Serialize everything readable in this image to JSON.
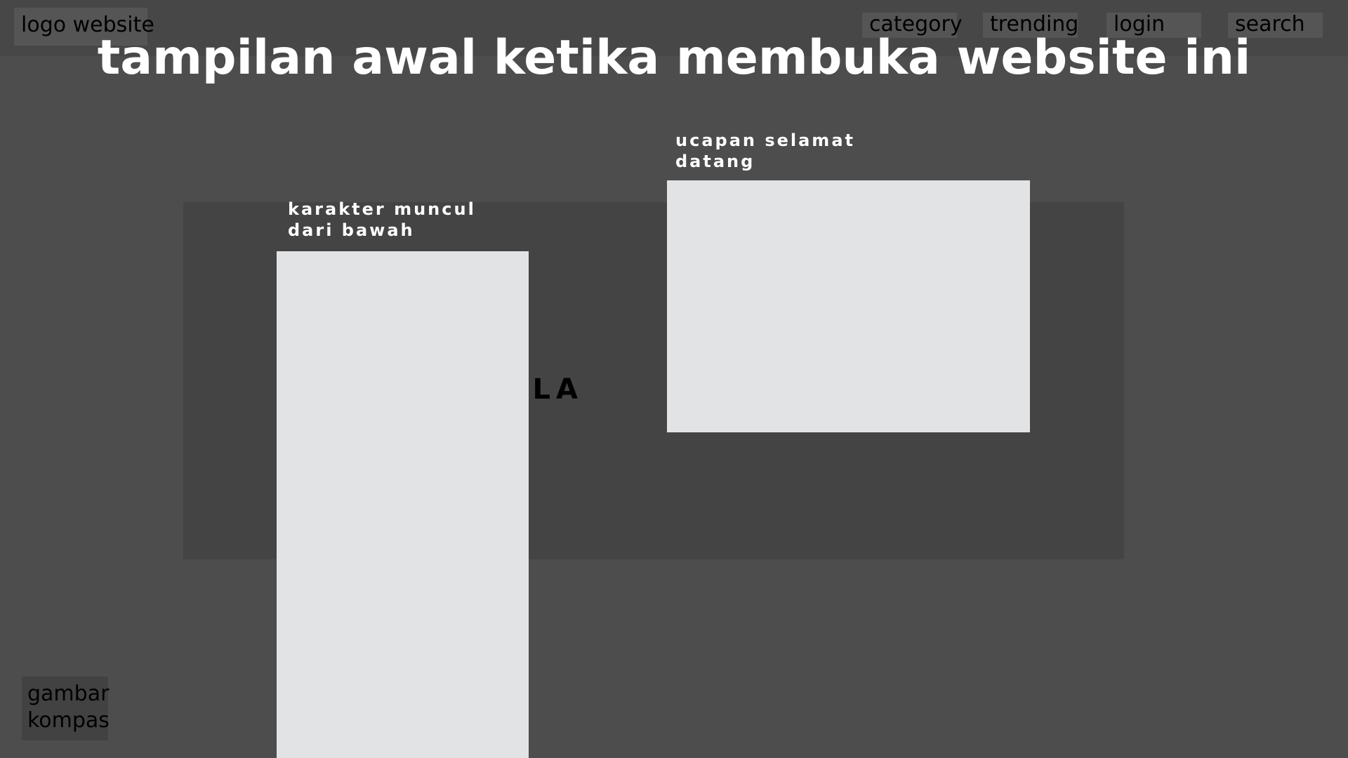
{
  "header": {
    "logo_label": "logo website",
    "nav": {
      "category": "category",
      "trending": "trending",
      "login": "login",
      "search": "search"
    }
  },
  "page_title": "tampilan awal ketika membuka website ini",
  "main": {
    "panel_text": "R PULA",
    "character_caption": "karakter muncul\ndari bawah",
    "welcome_caption": "ucapan selamat\ndatang"
  },
  "footer": {
    "compass_label": "gambar\nkompas"
  },
  "colors": {
    "background": "#4d4d4d",
    "panel": "#444444",
    "placeholder": "#e2e3e5",
    "title_text": "#ffffff"
  }
}
